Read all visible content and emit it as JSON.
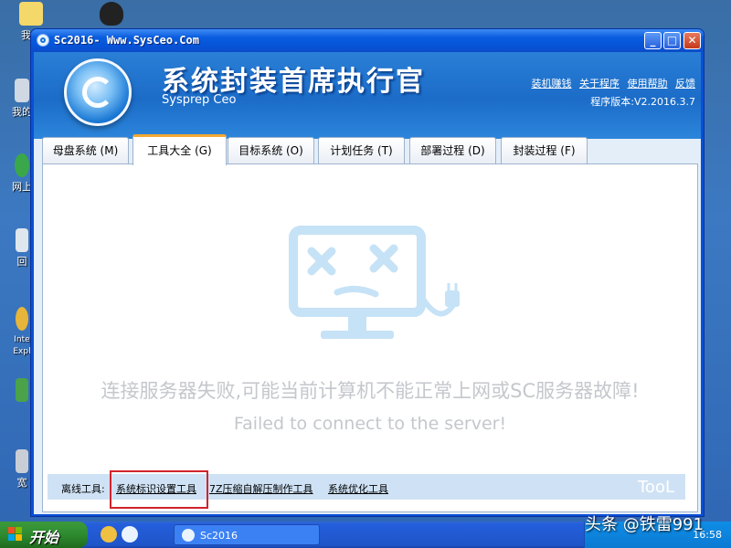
{
  "window": {
    "title": "Sc2016- Www.SysCeo.Com",
    "minimize": "_",
    "maximize": "□",
    "close": "✕"
  },
  "header": {
    "app_name": "系统封装首席执行官",
    "app_sub": "Sysprep Ceo",
    "links": [
      "装机赚钱",
      "关于程序",
      "使用帮助",
      "反馈"
    ],
    "version": "程序版本:V2.2016.3.7"
  },
  "tabs": [
    {
      "label": "母盘系统 (M)"
    },
    {
      "label": "工具大全 (G)",
      "active": true
    },
    {
      "label": "目标系统 (O)"
    },
    {
      "label": "计划任务 (T)"
    },
    {
      "label": "部署过程 (D)"
    },
    {
      "label": "封装过程 (F)"
    }
  ],
  "panel": {
    "error_cn": "连接服务器失败,可能当前计算机不能正常上网或SC服务器故障!",
    "error_en": "Failed to connect to the server!",
    "icon": "disconnected-monitor-icon"
  },
  "toolbar": {
    "label": "离线工具:",
    "tools": [
      "系统标识设置工具",
      "7Z压缩自解压制作工具",
      "系统优化工具"
    ],
    "badge": "TooL"
  },
  "taskbar": {
    "start": "开始",
    "task": "Sc2016",
    "clock": "16:58"
  },
  "watermark": "头条 @铁雷991",
  "colors": {
    "accent": "#0a4fd6",
    "header_blue": "#1b6cc8",
    "highlight": "#d0242c"
  }
}
